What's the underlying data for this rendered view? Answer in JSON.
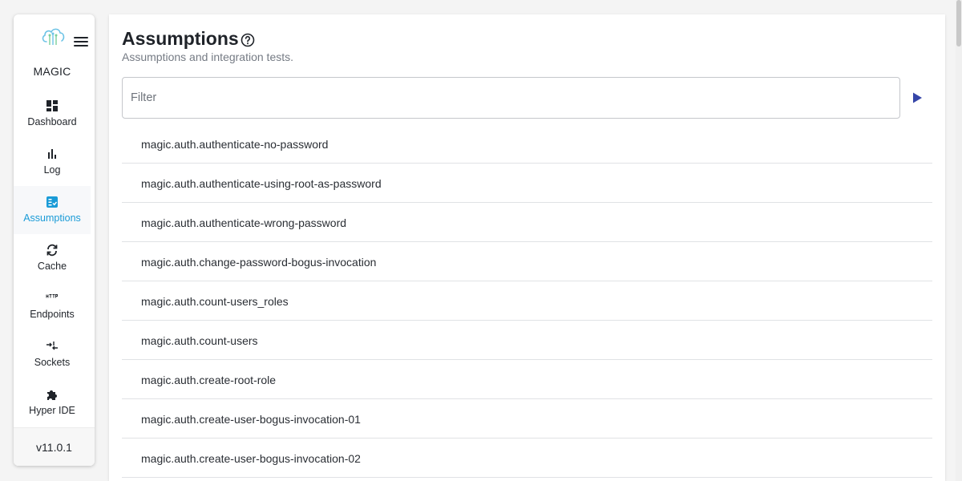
{
  "brand": {
    "name": "MAGIC",
    "logo_icon": "cloud-circuit-icon",
    "accent_color": "#1a9bd7"
  },
  "sidebar": {
    "items": [
      {
        "label": "Dashboard",
        "icon": "dashboard-icon",
        "active": false
      },
      {
        "label": "Log",
        "icon": "bar-chart-icon",
        "active": false
      },
      {
        "label": "Assumptions",
        "icon": "checklist-icon",
        "active": true
      },
      {
        "label": "Cache",
        "icon": "refresh-icon",
        "active": false
      },
      {
        "label": "Endpoints",
        "icon": "http-icon",
        "active": false
      },
      {
        "label": "Sockets",
        "icon": "sockets-icon",
        "active": false
      },
      {
        "label": "Hyper IDE",
        "icon": "puzzle-icon",
        "active": false
      }
    ],
    "version": "v11.0.1"
  },
  "page": {
    "title": "Assumptions",
    "subtitle": "Assumptions and integration tests."
  },
  "filter": {
    "placeholder": "Filter",
    "value": ""
  },
  "assumptions": [
    "magic.auth.authenticate-no-password",
    "magic.auth.authenticate-using-root-as-password",
    "magic.auth.authenticate-wrong-password",
    "magic.auth.change-password-bogus-invocation",
    "magic.auth.count-users_roles",
    "magic.auth.count-users",
    "magic.auth.create-root-role",
    "magic.auth.create-user-bogus-invocation-01",
    "magic.auth.create-user-bogus-invocation-02"
  ]
}
